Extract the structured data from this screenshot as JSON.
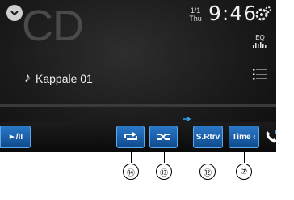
{
  "header": {
    "source_bg_text": "CD",
    "track_count": "1/1",
    "day": "Thu",
    "clock": "9:46",
    "eq_label": "EQ"
  },
  "track": {
    "title": "Kappale 01"
  },
  "progress": {
    "fraction": 0.0
  },
  "bottom_bar": {
    "play_label": "►/II",
    "repeat_icon": "repeat-icon",
    "shuffle_icon": "shuffle-icon",
    "srtrv_label": "S.Rtrv",
    "time_label": "Time ‹"
  },
  "callouts": [
    "⑭",
    "⑬",
    "⑫",
    "⑦"
  ],
  "colors": {
    "accent": "#2a78c8",
    "highlight": "#39a0f0",
    "background": "#1a1a1a"
  }
}
